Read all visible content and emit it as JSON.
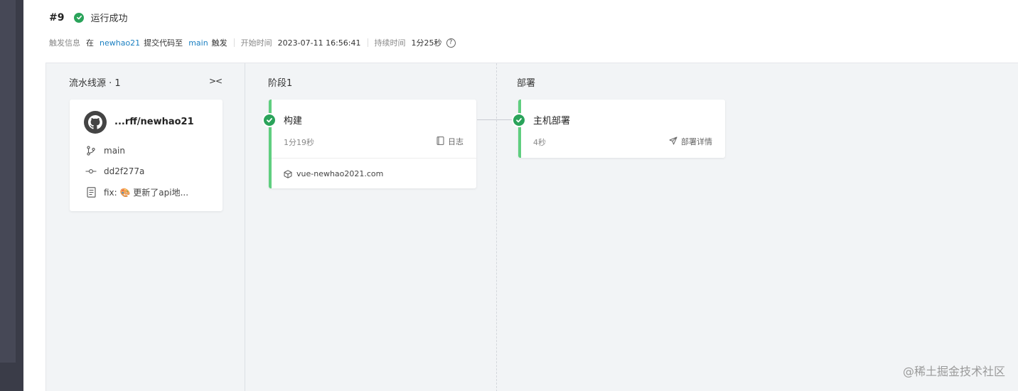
{
  "run": {
    "number": "#9",
    "status": "运行成功"
  },
  "meta": {
    "trigger_label": "触发信息",
    "at": "在",
    "user": "newhao21",
    "action": "提交代码至",
    "branch": "main",
    "trigger": "触发",
    "start_label": "开始时间",
    "start_time": "2023-07-11 16:56:41",
    "duration_label": "持续时间",
    "duration": "1分25秒",
    "help": "?"
  },
  "pipeline": {
    "source_col": {
      "title": "流水线源 · 1",
      "collapse": "><",
      "repo": "...rff/newhao21",
      "branch": "main",
      "commit": "dd2f277a",
      "message": "fix: 🎨 更新了api地..."
    },
    "stage1": {
      "title": "阶段1",
      "job": {
        "name": "构建",
        "duration": "1分19秒",
        "action": "日志",
        "artifact": "vue-newhao2021.com"
      }
    },
    "deploy": {
      "title": "部署",
      "job": {
        "name": "主机部署",
        "duration": "4秒",
        "action": "部署详情"
      }
    }
  },
  "watermark": "@稀土掘金技术社区",
  "colors": {
    "success": "#2aa35a",
    "job_border": "#5fce7f",
    "link": "#1a7fc1",
    "canvas_bg": "#f2f4f6",
    "sidebar": "#3a3c48"
  }
}
